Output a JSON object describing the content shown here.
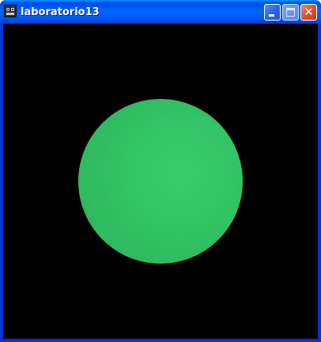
{
  "window": {
    "title": "laboratorio13",
    "buttons": {
      "minimize_icon": "minimize-icon",
      "maximize_icon": "maximize-icon",
      "close_icon": "close-icon",
      "close_glyph": "✕"
    }
  },
  "scene": {
    "background_color": "#000000",
    "sphere_color": "#33c467"
  }
}
